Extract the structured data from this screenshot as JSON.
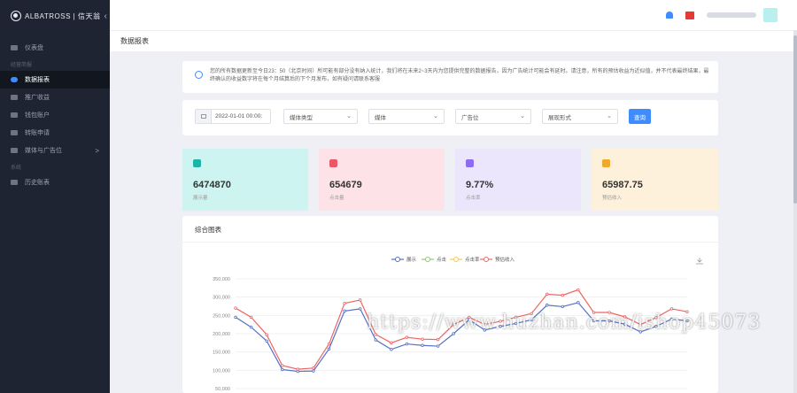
{
  "sidebar": {
    "brand": "ALBATROSS | 信天翁",
    "items": [
      {
        "label": "仪表盘",
        "active": false
      },
      {
        "group": "经营简报"
      },
      {
        "label": "数据报表",
        "active": true
      },
      {
        "label": "推广收益",
        "active": false
      },
      {
        "label": "钱包账户",
        "active": false
      },
      {
        "label": "转账申请",
        "active": false
      },
      {
        "label": "媒体与广告位",
        "active": false,
        "arrow": ">"
      },
      {
        "group": "系统"
      },
      {
        "label": "历史账表",
        "active": false
      }
    ]
  },
  "topbar": {
    "icons": [
      "bell-icon",
      "flag-icon"
    ]
  },
  "page": {
    "title": "数据报表"
  },
  "notice": {
    "text": "您的所有数据更新至今日23：50（北京时间）所可能有部分没有纳入统计，我们将在未来2~3天内为您提供完整的数据报告，因为广告统计可能会有延时。请注意，所有的预估收益为近似值，并不代表最终结果，最终确认的收益数字将在每个月结算后的下个月发布，如有疑问请联系客服"
  },
  "filters": {
    "date": "2022-01-01 00:00:",
    "selects": [
      "媒体类型",
      "媒体",
      "广告位",
      "展现形式"
    ],
    "query_label": "查询"
  },
  "stats": [
    {
      "value": "6474870",
      "label": "展示量",
      "color": "#cdf4f0",
      "icon_color": "#19b6a8"
    },
    {
      "value": "654679",
      "label": "点击量",
      "color": "#fde3e8",
      "icon_color": "#ee5568"
    },
    {
      "value": "9.77%",
      "label": "点击率",
      "color": "#ece6fc",
      "icon_color": "#8c6cf0"
    },
    {
      "value": "65987.75",
      "label": "预估收入",
      "color": "#fdf1dc",
      "icon_color": "#f0a92a"
    }
  ],
  "chart_panel": {
    "title": "综合图表"
  },
  "chart_data": {
    "type": "line",
    "legend": [
      "展示",
      "点击",
      "点击率",
      "预估收入"
    ],
    "legend_position": "top-center",
    "ylim": [
      50000,
      350000
    ],
    "yticks": [
      "350,000",
      "300,000",
      "250,000",
      "200,000",
      "150,000",
      "100,000",
      "50,000"
    ],
    "grid": true,
    "series": [
      {
        "name": "展示",
        "color": "#5470c6",
        "values": [
          245000,
          218000,
          180000,
          102000,
          97000,
          98000,
          158000,
          262000,
          268000,
          183000,
          157000,
          172000,
          168000,
          166000,
          200000,
          238000,
          210000,
          220000,
          228000,
          238000,
          278000,
          274000,
          285000,
          235000,
          235000,
          226000,
          205000,
          220000,
          240000,
          235000
        ]
      },
      {
        "name": "点击",
        "color": "#91cc75",
        "values": []
      },
      {
        "name": "点击率",
        "color": "#fac858",
        "values": []
      },
      {
        "name": "预估收入",
        "color": "#ee6666",
        "values": [
          270000,
          245000,
          197000,
          113000,
          103000,
          106000,
          172000,
          283000,
          292000,
          198000,
          175000,
          190000,
          185000,
          184000,
          225000,
          245000,
          225000,
          234000,
          245000,
          255000,
          308000,
          305000,
          320000,
          258000,
          258000,
          246000,
          225000,
          244000,
          268000,
          260000
        ]
      }
    ]
  },
  "watermark": "https://www.huzhan.com/ishop45073"
}
